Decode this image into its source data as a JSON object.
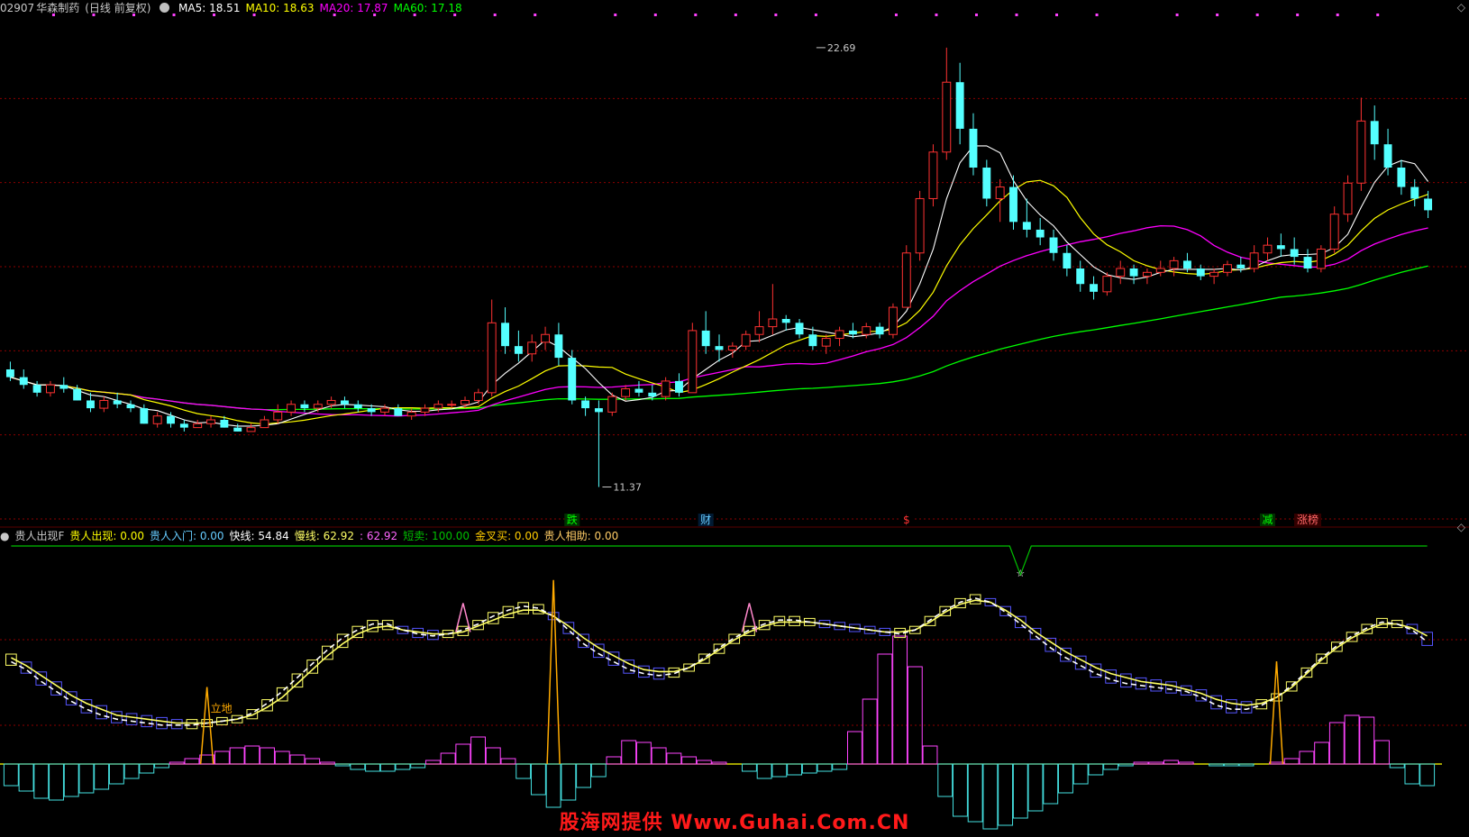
{
  "title": {
    "code": "02907",
    "name": "华森制药",
    "period": "(日线 前复权)"
  },
  "ma_legend": [
    {
      "label": "MA5: 18.51",
      "color": "#ffffff"
    },
    {
      "label": "MA10: 18.63",
      "color": "#ffff00"
    },
    {
      "label": "MA20: 17.87",
      "color": "#ff00ff"
    },
    {
      "label": "MA60: 17.18",
      "color": "#00ff00"
    }
  ],
  "indicator_legend": [
    {
      "label": "贵人出现F",
      "color": "#c8c8c8"
    },
    {
      "label": "贵人出现: 0.00",
      "color": "#ffff00"
    },
    {
      "label": "贵人入门: 0.00",
      "color": "#66ccff"
    },
    {
      "label": "快线: 54.84",
      "color": "#ffffff"
    },
    {
      "label": "慢线: 62.92",
      "color": "#ffff66"
    },
    {
      "label": ": 62.92",
      "color": "#ff66ff"
    },
    {
      "label": "短卖: 100.00",
      "color": "#00c000"
    },
    {
      "label": "金叉买: 0.00",
      "color": "#ffcc00"
    },
    {
      "label": "贵人相助: 0.00",
      "color": "#ffcc66"
    }
  ],
  "price_markers": [
    {
      "label": "22.69",
      "day": 60,
      "price": 22.69
    },
    {
      "label": "11.37",
      "day": 44,
      "price": 11.37
    }
  ],
  "event_labels": [
    {
      "text": "跌",
      "day": 42,
      "color": "#00ff00",
      "bg": "#003000"
    },
    {
      "text": "财",
      "day": 52,
      "color": "#66ccff",
      "bg": "#001a33"
    },
    {
      "text": "$",
      "day": 67,
      "color": "#ff3333",
      "bg": "#000000"
    },
    {
      "text": "减",
      "day": 94,
      "color": "#00ff00",
      "bg": "#003000"
    },
    {
      "text": "涨榜",
      "day": 97,
      "color": "#ff6666",
      "bg": "#330000"
    }
  ],
  "annotation_lidi": "立地",
  "watermark": "股海网提供 Www.Guhai.Com.CN",
  "colors": {
    "up": "#ff3232",
    "down": "#54ffff",
    "ma5": "#ffffff",
    "ma10": "#ffff00",
    "ma20": "#ff00ff",
    "ma60": "#00ff00",
    "grid": "#8b0000",
    "macd_pos": "#ff44ff",
    "macd_neg": "#44e0e0",
    "fast": "#ffffff",
    "slow_up": "#ffff66",
    "slow_dn": "#5555ff",
    "spike": "#ffaa00",
    "spike_pink": "#ff88cc",
    "top_line": "#00c000"
  },
  "chart_data": {
    "type": "candlestick",
    "price_range": [
      10.5,
      23.5
    ],
    "candles": [
      [
        14.4,
        14.6,
        14.1,
        14.2
      ],
      [
        14.2,
        14.4,
        13.9,
        14.0
      ],
      [
        14.0,
        14.1,
        13.7,
        13.8
      ],
      [
        13.8,
        14.1,
        13.7,
        14.0
      ],
      [
        14.0,
        14.2,
        13.8,
        13.9
      ],
      [
        13.9,
        14.0,
        13.6,
        13.6
      ],
      [
        13.6,
        13.8,
        13.3,
        13.4
      ],
      [
        13.4,
        13.7,
        13.3,
        13.6
      ],
      [
        13.6,
        13.8,
        13.4,
        13.5
      ],
      [
        13.5,
        13.6,
        13.3,
        13.4
      ],
      [
        13.4,
        13.5,
        13.0,
        13.0
      ],
      [
        13.0,
        13.3,
        12.9,
        13.2
      ],
      [
        13.2,
        13.3,
        12.9,
        13.0
      ],
      [
        13.0,
        13.1,
        12.8,
        12.9
      ],
      [
        12.9,
        13.1,
        12.9,
        13.0
      ],
      [
        13.0,
        13.2,
        12.9,
        13.1
      ],
      [
        13.1,
        13.2,
        12.9,
        12.9
      ],
      [
        12.9,
        13.0,
        12.8,
        12.8
      ],
      [
        12.8,
        13.0,
        12.8,
        12.9
      ],
      [
        12.9,
        13.2,
        12.9,
        13.1
      ],
      [
        13.1,
        13.5,
        13.0,
        13.3
      ],
      [
        13.3,
        13.6,
        13.2,
        13.5
      ],
      [
        13.5,
        13.6,
        13.3,
        13.4
      ],
      [
        13.4,
        13.6,
        13.3,
        13.5
      ],
      [
        13.5,
        13.7,
        13.4,
        13.6
      ],
      [
        13.6,
        13.7,
        13.4,
        13.5
      ],
      [
        13.5,
        13.6,
        13.3,
        13.4
      ],
      [
        13.4,
        13.5,
        13.2,
        13.3
      ],
      [
        13.3,
        13.5,
        13.2,
        13.4
      ],
      [
        13.4,
        13.5,
        13.2,
        13.2
      ],
      [
        13.2,
        13.4,
        13.1,
        13.3
      ],
      [
        13.3,
        13.5,
        13.2,
        13.4
      ],
      [
        13.4,
        13.6,
        13.3,
        13.5
      ],
      [
        13.5,
        13.6,
        13.4,
        13.5
      ],
      [
        13.5,
        13.7,
        13.4,
        13.6
      ],
      [
        13.6,
        13.9,
        13.5,
        13.8
      ],
      [
        13.8,
        16.2,
        13.7,
        15.6
      ],
      [
        15.6,
        16.0,
        14.8,
        15.0
      ],
      [
        15.0,
        15.4,
        14.6,
        14.8
      ],
      [
        14.8,
        15.3,
        14.6,
        15.1
      ],
      [
        15.1,
        15.5,
        14.9,
        15.3
      ],
      [
        15.3,
        15.6,
        14.5,
        14.7
      ],
      [
        14.7,
        14.9,
        13.5,
        13.6
      ],
      [
        13.6,
        13.7,
        13.2,
        13.4
      ],
      [
        13.4,
        13.6,
        11.37,
        13.3
      ],
      [
        13.3,
        13.8,
        13.2,
        13.7
      ],
      [
        13.7,
        14.0,
        13.6,
        13.9
      ],
      [
        13.9,
        14.1,
        13.7,
        13.8
      ],
      [
        13.8,
        14.0,
        13.6,
        13.7
      ],
      [
        13.7,
        14.2,
        13.6,
        14.1
      ],
      [
        14.1,
        14.3,
        13.7,
        13.8
      ],
      [
        13.8,
        15.6,
        13.8,
        15.4
      ],
      [
        15.4,
        15.9,
        14.8,
        15.0
      ],
      [
        15.0,
        15.3,
        14.6,
        14.9
      ],
      [
        14.9,
        15.1,
        14.7,
        15.0
      ],
      [
        15.0,
        15.4,
        14.9,
        15.3
      ],
      [
        15.3,
        15.9,
        15.1,
        15.5
      ],
      [
        15.5,
        16.6,
        15.3,
        15.7
      ],
      [
        15.7,
        15.8,
        15.4,
        15.6
      ],
      [
        15.6,
        15.7,
        15.2,
        15.3
      ],
      [
        15.3,
        15.5,
        14.9,
        15.0
      ],
      [
        15.0,
        15.3,
        14.8,
        15.2
      ],
      [
        15.2,
        15.5,
        15.0,
        15.4
      ],
      [
        15.4,
        15.6,
        15.2,
        15.3
      ],
      [
        15.3,
        15.6,
        15.2,
        15.5
      ],
      [
        15.5,
        15.6,
        15.2,
        15.3
      ],
      [
        15.3,
        16.1,
        15.2,
        16.0
      ],
      [
        16.0,
        17.6,
        16.0,
        17.4
      ],
      [
        17.4,
        19.0,
        17.2,
        18.8
      ],
      [
        18.8,
        20.2,
        18.6,
        20.0
      ],
      [
        20.0,
        22.69,
        19.8,
        21.8
      ],
      [
        21.8,
        22.3,
        20.2,
        20.6
      ],
      [
        20.6,
        21.0,
        19.4,
        19.6
      ],
      [
        19.6,
        19.8,
        18.6,
        18.8
      ],
      [
        18.8,
        19.3,
        18.2,
        19.1
      ],
      [
        19.1,
        19.4,
        18.0,
        18.2
      ],
      [
        18.2,
        18.8,
        17.8,
        18.0
      ],
      [
        18.0,
        18.3,
        17.6,
        17.8
      ],
      [
        17.8,
        18.0,
        17.2,
        17.4
      ],
      [
        17.4,
        17.6,
        16.8,
        17.0
      ],
      [
        17.0,
        17.2,
        16.4,
        16.6
      ],
      [
        16.6,
        16.8,
        16.2,
        16.4
      ],
      [
        16.4,
        16.9,
        16.3,
        16.8
      ],
      [
        16.8,
        17.2,
        16.6,
        17.0
      ],
      [
        17.0,
        17.1,
        16.6,
        16.8
      ],
      [
        16.8,
        17.0,
        16.6,
        16.9
      ],
      [
        16.9,
        17.2,
        16.8,
        17.0
      ],
      [
        17.0,
        17.3,
        16.8,
        17.2
      ],
      [
        17.2,
        17.4,
        16.9,
        17.0
      ],
      [
        17.0,
        17.1,
        16.7,
        16.8
      ],
      [
        16.8,
        17.0,
        16.6,
        16.9
      ],
      [
        16.9,
        17.2,
        16.8,
        17.1
      ],
      [
        17.1,
        17.3,
        16.9,
        17.0
      ],
      [
        17.0,
        17.6,
        16.9,
        17.4
      ],
      [
        17.4,
        17.8,
        17.2,
        17.6
      ],
      [
        17.6,
        17.9,
        17.3,
        17.5
      ],
      [
        17.5,
        17.8,
        17.1,
        17.3
      ],
      [
        17.3,
        17.5,
        16.9,
        17.0
      ],
      [
        17.0,
        17.6,
        16.9,
        17.5
      ],
      [
        17.5,
        18.6,
        17.4,
        18.4
      ],
      [
        18.4,
        19.4,
        18.2,
        19.2
      ],
      [
        19.2,
        21.4,
        19.0,
        20.8
      ],
      [
        20.8,
        21.2,
        19.8,
        20.2
      ],
      [
        20.2,
        20.6,
        19.4,
        19.6
      ],
      [
        19.6,
        19.8,
        18.9,
        19.1
      ],
      [
        19.1,
        19.3,
        18.6,
        18.8
      ],
      [
        18.8,
        19.0,
        18.3,
        18.5
      ]
    ],
    "ma5": [],
    "ma10": [],
    "ma20": [],
    "ma60": [],
    "indicator": {
      "fast": [
        48,
        44,
        38,
        33,
        28,
        24,
        21,
        19,
        18,
        17,
        16,
        16,
        16,
        17,
        18,
        19,
        22,
        27,
        33,
        40,
        47,
        54,
        60,
        64,
        67,
        67,
        64,
        62,
        61,
        62,
        64,
        67,
        71,
        74,
        76,
        75,
        71,
        64,
        57,
        52,
        48,
        44,
        42,
        41,
        42,
        45,
        50,
        55,
        60,
        64,
        67,
        69,
        69,
        68,
        67,
        66,
        65,
        64,
        63,
        62,
        64,
        69,
        74,
        78,
        80,
        78,
        73,
        67,
        61,
        55,
        50,
        46,
        42,
        39,
        37,
        36,
        35,
        34,
        33,
        30,
        26,
        24,
        24,
        26,
        30,
        36,
        43,
        50,
        56,
        61,
        65,
        68,
        67,
        64,
        58
      ],
      "slow": [
        50,
        46,
        41,
        36,
        31,
        27,
        24,
        21,
        20,
        19,
        18,
        17,
        17,
        17,
        18,
        19,
        21,
        25,
        30,
        37,
        44,
        51,
        57,
        62,
        65,
        66,
        64,
        63,
        62,
        62,
        63,
        66,
        69,
        72,
        74,
        74,
        71,
        66,
        60,
        55,
        51,
        47,
        44,
        43,
        43,
        45,
        49,
        54,
        59,
        63,
        66,
        68,
        68,
        68,
        67,
        66,
        65,
        64,
        63,
        63,
        64,
        68,
        73,
        77,
        79,
        78,
        74,
        69,
        63,
        58,
        53,
        49,
        45,
        42,
        40,
        38,
        37,
        36,
        34,
        32,
        29,
        27,
        26,
        27,
        30,
        35,
        42,
        49,
        55,
        60,
        64,
        67,
        67,
        65,
        61
      ],
      "macd": [
        -1.2,
        -1.5,
        -1.9,
        -2.0,
        -1.8,
        -1.6,
        -1.4,
        -1.1,
        -0.8,
        -0.5,
        -0.2,
        0.1,
        0.3,
        0.5,
        0.7,
        0.9,
        1.0,
        0.9,
        0.7,
        0.5,
        0.3,
        0.1,
        -0.1,
        -0.3,
        -0.4,
        -0.4,
        -0.3,
        -0.2,
        0.2,
        0.6,
        1.1,
        1.5,
        0.9,
        0.3,
        -0.8,
        -1.7,
        -2.4,
        -2.0,
        -1.3,
        -0.7,
        0.4,
        1.3,
        1.2,
        0.9,
        0.6,
        0.4,
        0.2,
        0.1,
        0.0,
        -0.4,
        -0.8,
        -0.7,
        -0.6,
        -0.5,
        -0.4,
        -0.3,
        1.8,
        3.6,
        6.1,
        7.1,
        5.4,
        1.0,
        -1.8,
        -2.9,
        -3.2,
        -3.6,
        -3.4,
        -3.0,
        -2.6,
        -2.2,
        -1.6,
        -1.1,
        -0.6,
        -0.3,
        -0.1,
        0.1,
        0.1,
        0.2,
        0.1,
        0.0,
        -0.1,
        -0.1,
        -0.1,
        0.0,
        0.1,
        0.3,
        0.7,
        1.2,
        2.3,
        2.7,
        2.6,
        1.3,
        -0.2,
        -1.1,
        -1.2
      ],
      "spikes_orange": [
        13,
        36,
        84
      ],
      "spikes_pink": [
        30,
        49
      ],
      "dip_day": 67
    }
  }
}
